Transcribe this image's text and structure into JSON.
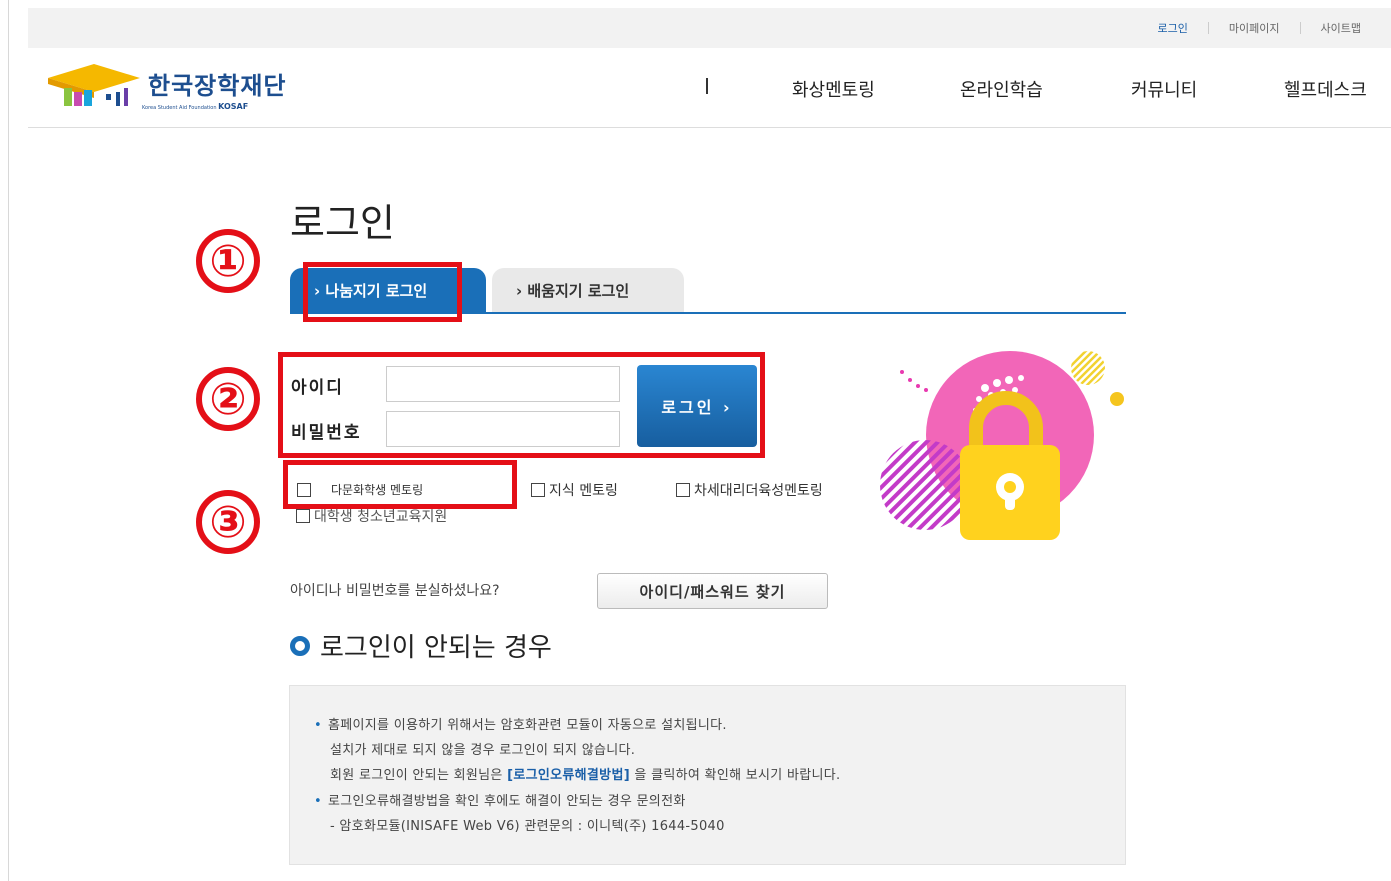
{
  "top_links": [
    "로그인",
    "마이페이지",
    "사이트맵"
  ],
  "logo": {
    "name": "한국장학재단",
    "sub": "Korea Student Aid Foundation",
    "sub_bold": "KOSAF"
  },
  "nav": [
    "화상멘토링",
    "온라인학습",
    "커뮤니티",
    "헬프데스크"
  ],
  "page_title": "로그인",
  "tabs": [
    "› 나눔지기 로그인",
    "› 배움지기 로그인"
  ],
  "form": {
    "id_label": "아이디",
    "pw_label": "비밀번호",
    "id_value": "",
    "pw_value": "",
    "login_button": "로그인 ›"
  },
  "callouts": [
    "①",
    "②",
    "③"
  ],
  "programs": [
    "다문화학생 멘토링",
    "지식 멘토링",
    "차세대리더육성멘토링",
    "대학생 청소년교육지원"
  ],
  "find": {
    "question": "아이디나 비밀번호를 분실하셨나요?",
    "button": "아이디/패스워드 찾기"
  },
  "trouble": {
    "title": "로그인이 안되는 경우",
    "lines": [
      "홈페이지를 이용하기 위해서는 암호화관련 모듈이 자동으로 설치됩니다.",
      "설치가 제대로 되지 않을 경우 로그인이 되지 않습니다.",
      "회원 로그인이 안되는 회원님은",
      "[로그인오류해결방법]",
      "을 클릭하여 확인해 보시기 바랍니다.",
      "로그인오류해결방법을 확인 후에도 해결이 안되는 경우 문의전화",
      "- 암호화모듈(INISAFE Web V6) 관련문의 : 이니텍(주) 1644-5040"
    ]
  },
  "colors": {
    "primary": "#1a6fb8",
    "callout": "#e40f17",
    "logo": "#1d4e8f"
  }
}
